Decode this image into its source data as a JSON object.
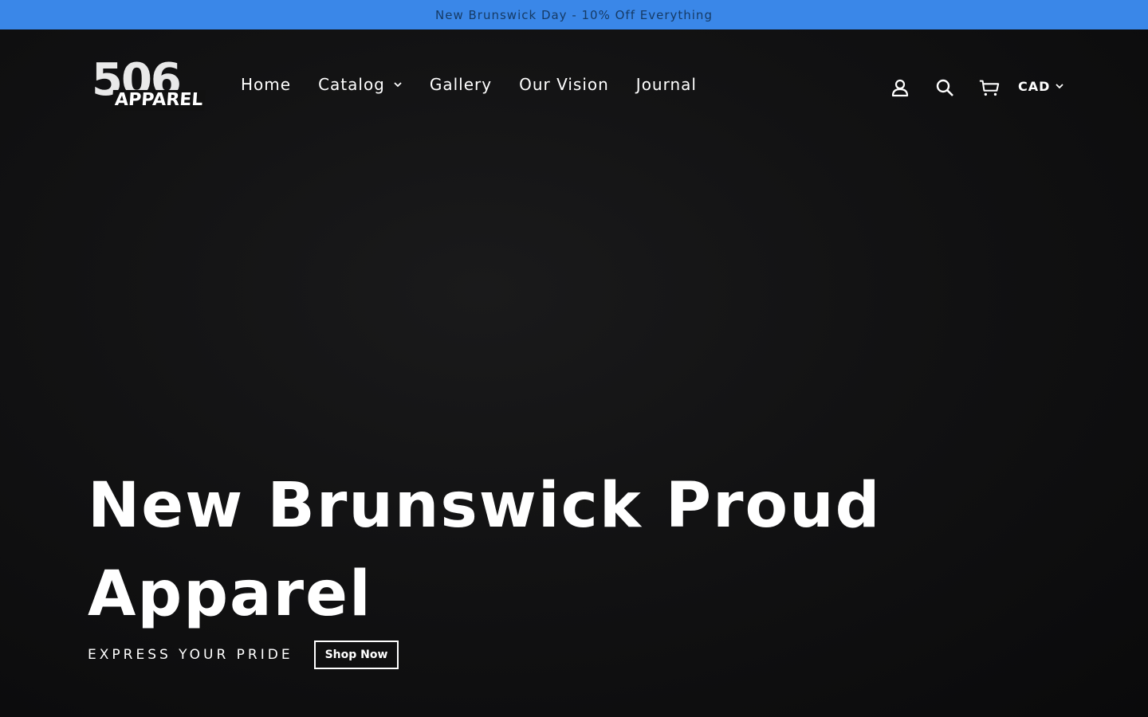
{
  "announcement": {
    "text": "New Brunswick Day - 10% Off Everything"
  },
  "logo": {
    "number": "506",
    "word": "APPAREL"
  },
  "nav": {
    "items": [
      {
        "label": "Home",
        "has_dropdown": false
      },
      {
        "label": "Catalog",
        "has_dropdown": true
      },
      {
        "label": "Gallery",
        "has_dropdown": false
      },
      {
        "label": "Our Vision",
        "has_dropdown": false
      },
      {
        "label": "Journal",
        "has_dropdown": false
      }
    ]
  },
  "header_icons": [
    "account-icon",
    "search-icon",
    "cart-icon"
  ],
  "currency": {
    "selected": "CAD"
  },
  "hero": {
    "headline": "New Brunswick Proud Apparel",
    "tagline": "EXPRESS YOUR PRIDE",
    "button_label": "Shop Now"
  },
  "colors": {
    "announcement_bg": "#3a87e8",
    "announcement_text": "#163b66",
    "page_bg": "#0d0d0e",
    "text": "#ffffff"
  }
}
